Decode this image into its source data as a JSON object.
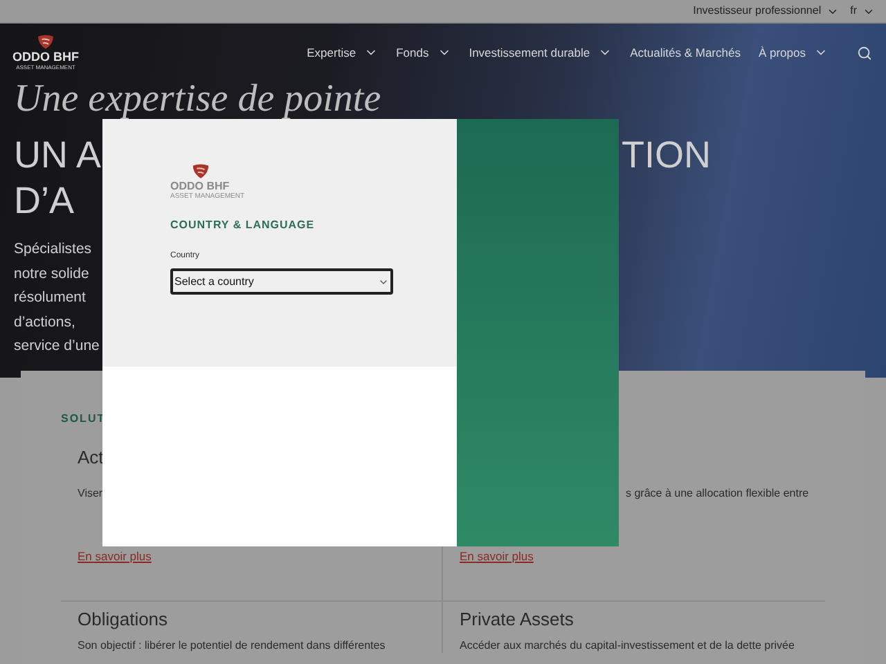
{
  "top_bar": {
    "items": [
      {
        "label": "Investisseur professionnel"
      },
      {
        "label": "fr"
      }
    ]
  },
  "header": {
    "logo": {
      "name": "ODDO BHF",
      "tagline": "ASSET MANAGEMENT"
    },
    "nav": [
      {
        "label": "Expertise",
        "has_menu": true
      },
      {
        "label": "Fonds",
        "has_menu": true
      },
      {
        "label": "Investissement durable",
        "has_menu": true
      },
      {
        "label": "Actualités & Marchés",
        "has_menu": false
      },
      {
        "label": "À propos",
        "has_menu": true
      }
    ]
  },
  "hero": {
    "kicker": "Une expertise de pointe",
    "title_lines": [
      {
        "left": "UN A",
        "right": "TION"
      },
      {
        "left": "D’A"
      }
    ],
    "text_lines": [
      "Spécialistes",
      "notre solide",
      "résolument",
      "d’actions,",
      "service d’une"
    ]
  },
  "solutions": {
    "title": "SOLUT",
    "cards": [
      {
        "title": "Act",
        "text": "Viser",
        "link": "En savoir plus"
      },
      {
        "text": "s grâce à une allocation flexible entre",
        "link": "En savoir plus"
      },
      {
        "title": "Obligations",
        "text": "Son objectif : libérer le potentiel de rendement dans différentes"
      },
      {
        "title": "Private Assets",
        "text": "Accéder aux marchés du capital-investissement et de la dette privée"
      }
    ]
  },
  "modal": {
    "logo": {
      "name": "ODDO BHF",
      "tagline": "ASSET MANAGEMENT"
    },
    "title": "COUNTRY & LANGUAGE",
    "field": {
      "label": "Country",
      "value": "Select a country"
    }
  }
}
